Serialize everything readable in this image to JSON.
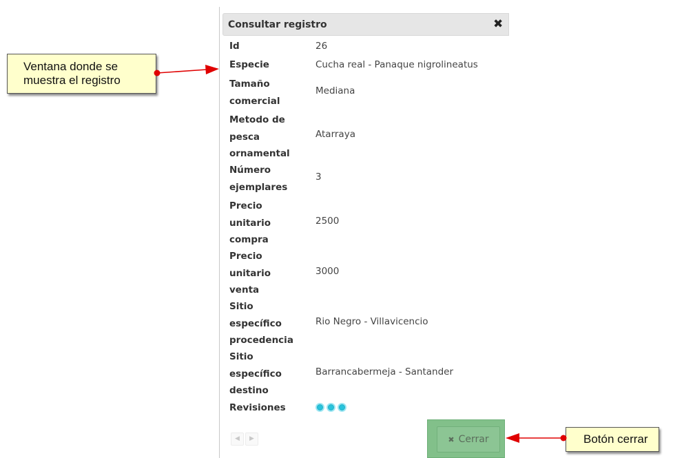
{
  "dialog": {
    "title": "Consultar registro",
    "close_glyph": "✖",
    "fields": [
      {
        "label": "Id",
        "value": "26"
      },
      {
        "label": "Especie",
        "value": "Cucha real - Panaque nigrolineatus"
      },
      {
        "label": "Tamaño comercial",
        "value": "Mediana"
      },
      {
        "label": "Metodo de pesca ornamental",
        "value": "Atarraya"
      },
      {
        "label": "Número ejemplares",
        "value": "3"
      },
      {
        "label": "Precio unitario compra",
        "value": "2500"
      },
      {
        "label": "Precio unitario venta",
        "value": "3000"
      },
      {
        "label": "Sitio específico procedencia",
        "value": "Rio Negro - Villavicencio"
      },
      {
        "label": "Sitio específico destino",
        "value": "Barrancabermeja - Santander"
      },
      {
        "label": "Revisiones",
        "value": ""
      }
    ],
    "revisiones_count": 3,
    "pager": {
      "prev": "◀",
      "next": "▶"
    },
    "close_button": {
      "icon": "✖",
      "label": "Cerrar"
    }
  },
  "annotations": {
    "window_callout": "Ventana donde se muestra el registro",
    "button_callout": "Botón cerrar"
  },
  "colors": {
    "titlebar": "#e6e6e6",
    "dot": "#29c3dc",
    "highlight": "#82c08a",
    "callout_bg": "#ffffcc",
    "arrow": "#e00000"
  }
}
